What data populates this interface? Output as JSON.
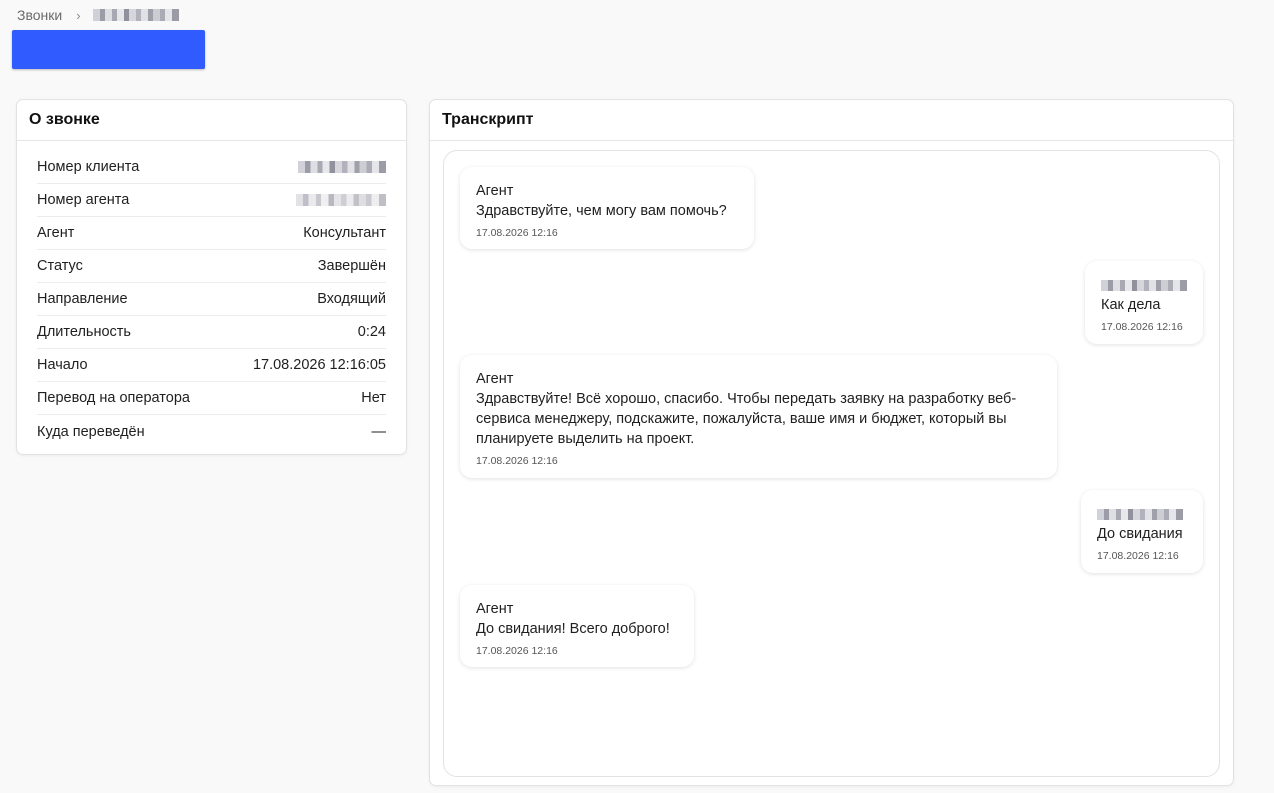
{
  "breadcrumb": {
    "root": "Звонки",
    "separator": "›"
  },
  "colors": {
    "accent": "#2f5bff",
    "page_bg": "#f9f9f9",
    "card_bg": "#ffffff"
  },
  "info_card": {
    "title": "О звонке",
    "rows": [
      {
        "label": "Номер клиента",
        "value": ""
      },
      {
        "label": "Номер агента",
        "value": ""
      },
      {
        "label": "Агент",
        "value": "Консультант"
      },
      {
        "label": "Статус",
        "value": "Завершён"
      },
      {
        "label": "Направление",
        "value": "Входящий"
      },
      {
        "label": "Длительность",
        "value": "0:24"
      },
      {
        "label": "Начало",
        "value": "17.08.2026 12:16:05"
      },
      {
        "label": "Перевод на оператора",
        "value": "Нет"
      },
      {
        "label": "Куда переведён",
        "value": "—"
      }
    ]
  },
  "transcript": {
    "title": "Транскрипт",
    "messages": [
      {
        "author": "Агент",
        "text": "Здравствуйте, чем могу вам помочь?",
        "time": "17.08.2026 12:16",
        "side": "left"
      },
      {
        "author": "",
        "text": "Как дела",
        "time": "17.08.2026 12:16",
        "side": "right"
      },
      {
        "author": "Агент",
        "text": "Здравствуйте! Всё хорошо, спасибо. Чтобы передать заявку на разработку веб-сервиса менеджеру, подскажите, пожалуйста, ваше имя и бюджет, который вы планируете выделить на проект.",
        "time": "17.08.2026 12:16",
        "side": "left"
      },
      {
        "author": "",
        "text": "До свидания",
        "time": "17.08.2026 12:16",
        "side": "right"
      },
      {
        "author": "Агент",
        "text": "До свидания! Всего доброго!",
        "time": "17.08.2026 12:16",
        "side": "left"
      }
    ]
  }
}
